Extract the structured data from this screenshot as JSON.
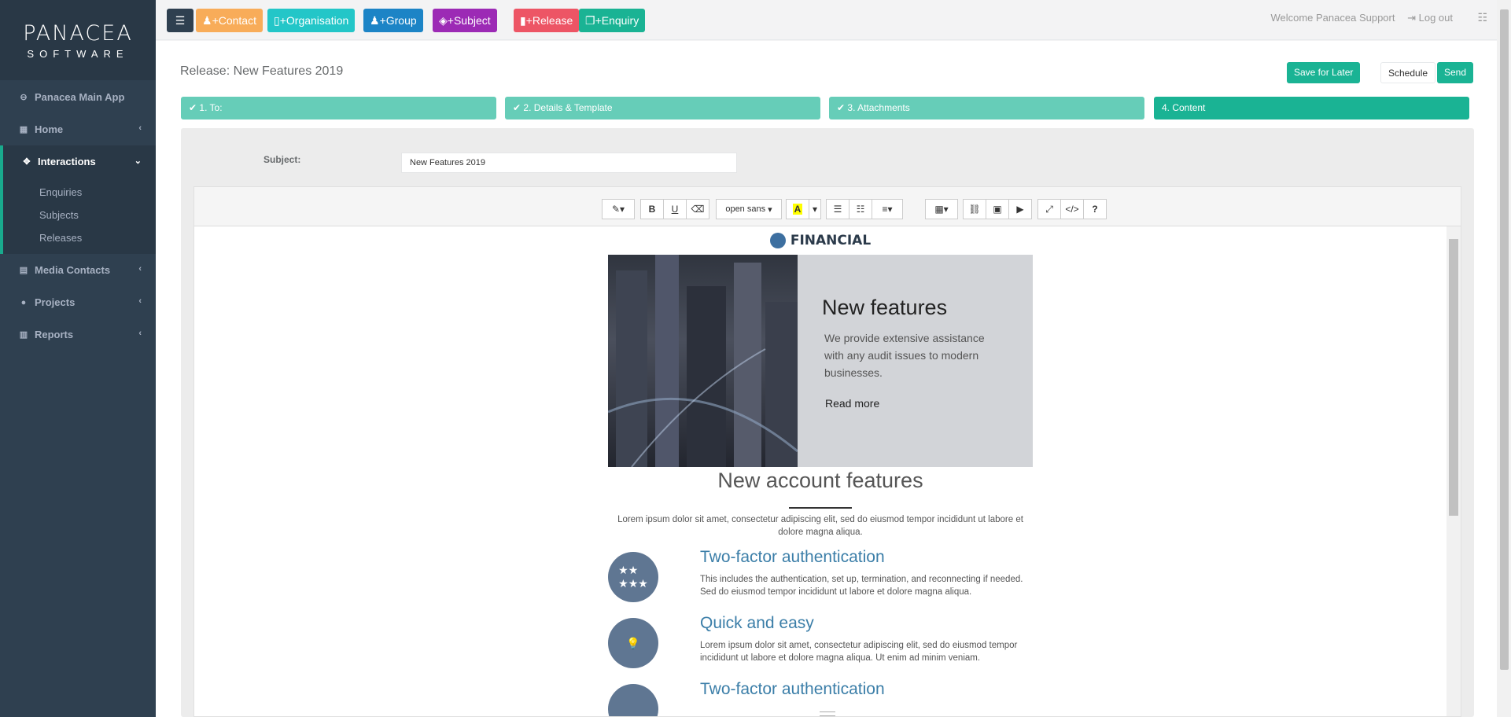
{
  "brand": {
    "line1": "PANACEA",
    "line2": "SOFTWARE"
  },
  "sidebar": {
    "items": [
      {
        "label": "Panacea Main App",
        "icon": "back-circle-icon"
      },
      {
        "label": "Home",
        "icon": "dashboard-icon"
      },
      {
        "label": "Interactions",
        "icon": "move-arrows-icon"
      },
      {
        "label": "Media Contacts",
        "icon": "address-card-icon"
      },
      {
        "label": "Projects",
        "icon": "question-circle-icon"
      },
      {
        "label": "Reports",
        "icon": "bar-chart-icon"
      }
    ],
    "sub_items": [
      "Enquiries",
      "Subjects",
      "Releases"
    ]
  },
  "topbar": {
    "buttons": [
      {
        "label": "+Contact",
        "color": "#f8ac59"
      },
      {
        "label": "+Organisation",
        "color": "#23c6c8"
      },
      {
        "label": "+Group",
        "color": "#1c84c6"
      },
      {
        "label": "+Subject",
        "color": "#9c2ab5"
      },
      {
        "label": "+Release",
        "color": "#ed5565"
      },
      {
        "label": "+Enquiry",
        "color": "#1ab394"
      }
    ],
    "welcome": "Welcome Panacea Support",
    "logout": "Log out"
  },
  "page": {
    "title": "Release: New Features 2019",
    "save_later": "Save for Later",
    "schedule": "Schedule",
    "send": "Send"
  },
  "steps": [
    {
      "label": "1. To:",
      "done": true
    },
    {
      "label": "2. Details & Template",
      "done": true
    },
    {
      "label": "3. Attachments",
      "done": true
    },
    {
      "label": "4. Content",
      "done": false
    }
  ],
  "form": {
    "subject_label": "Subject:",
    "subject_value": "New Features 2019"
  },
  "toolbar": {
    "font": "open sans"
  },
  "email": {
    "logo": "FINANCIAL",
    "hero_title": "New features",
    "hero_text": "We provide extensive assistance with any audit issues to modern businesses.",
    "hero_link": "Read more",
    "section_title": "New account features",
    "section_text": "Lorem ipsum dolor sit amet, consectetur adipiscing elit, sed do eiusmod tempor incididunt ut labore et dolore magna aliqua.",
    "features": [
      {
        "title": "Two-factor authentication",
        "text": "This includes the authentication, set up, termination, and reconnecting if needed. Sed do eiusmod tempor incididunt ut labore et dolore magna aliqua.",
        "icon": "stars-icon"
      },
      {
        "title": "Quick and easy",
        "text": "Lorem ipsum dolor sit amet, consectetur adipiscing elit, sed do eiusmod tempor incididunt ut labore et dolore magna aliqua. Ut enim ad minim veniam.",
        "icon": "lightbulb-icon"
      },
      {
        "title": "Two-factor authentication",
        "text": "",
        "icon": "circle-icon"
      }
    ]
  },
  "colors": {
    "sidebar": "#2f4050",
    "accent": "#19aa8d",
    "step_done": "#66cdb8",
    "step_active": "#1ab394"
  }
}
